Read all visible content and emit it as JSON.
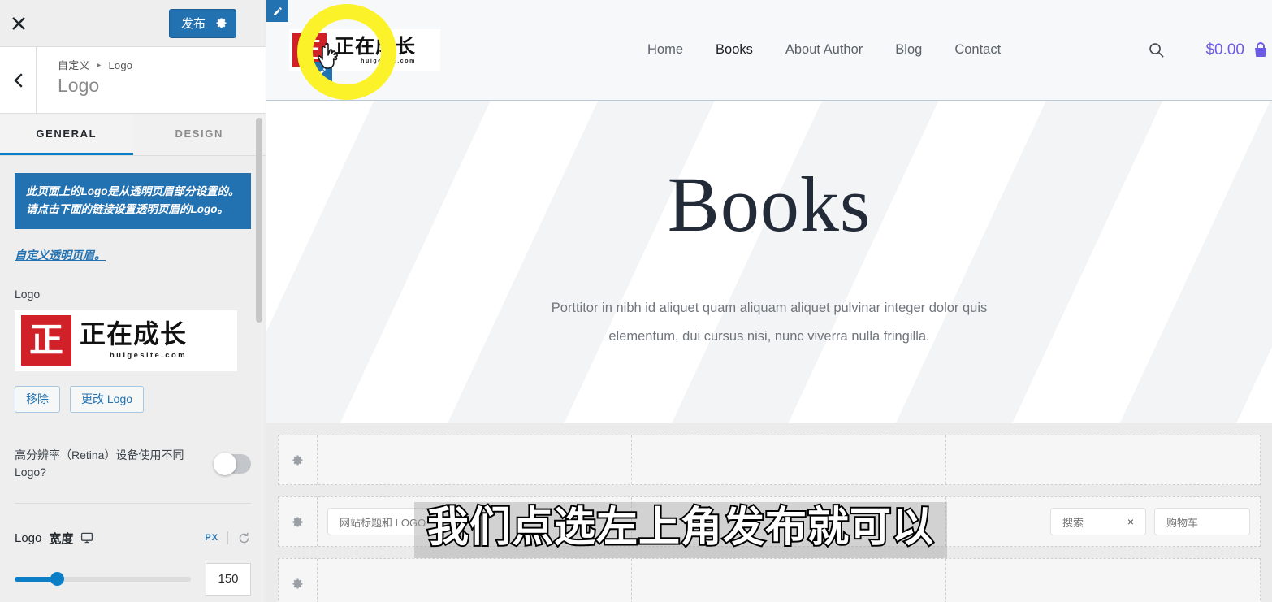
{
  "customizer": {
    "close_icon": "close-icon",
    "publish_label": "发布",
    "publish_gear_icon": "gear-icon",
    "back_icon": "chevron-left-icon",
    "breadcrumb_root": "自定义",
    "breadcrumb_sep": "▸",
    "breadcrumb_current": "Logo",
    "panel_title": "Logo",
    "tabs": [
      {
        "label": "GENERAL",
        "active": true
      },
      {
        "label": "DESIGN",
        "active": false
      }
    ],
    "notice_text": "此页面上的Logo是从透明页眉部分设置的。 请点击下面的链接设置透明页眉的Logo。",
    "notice_link": "自定义透明页眉。",
    "logo_field_label": "Logo",
    "logo": {
      "seal_char": "正",
      "cn_text": "正在成长",
      "domain": "huigesite.com",
      "seal_color": "#cf2127"
    },
    "remove_label": "移除",
    "change_label": "更改 Logo",
    "retina_label": "高分辨率（Retina）设备使用不同Logo?",
    "retina_enabled": false,
    "width_label_prefix": "Logo",
    "width_label_strong": "宽度",
    "width_device_icon": "desktop-icon",
    "width_unit": "PX",
    "width_reset_icon": "reset-icon",
    "width_value": "150"
  },
  "site": {
    "nav": [
      {
        "label": "Home",
        "current": false
      },
      {
        "label": "Books",
        "current": true
      },
      {
        "label": "About Author",
        "current": false
      },
      {
        "label": "Blog",
        "current": false
      },
      {
        "label": "Contact",
        "current": false
      }
    ],
    "search_icon": "search-icon",
    "cart_amount": "$0.00",
    "cart_icon": "shopping-cart-icon",
    "hero_title": "Books",
    "hero_paragraph": "Porttitor in nibh id aliquet quam aliquam aliquet pulvinar integer dolor quis elementum, dui cursus nisi, nunc viverra nulla fringilla.",
    "accent_cart_color": "#6b5ce7"
  },
  "builder": {
    "gear_icon": "gear-icon",
    "rows": [
      {
        "cells": [
          {},
          {},
          {}
        ]
      },
      {
        "cells": [
          {
            "chip": "网站标题和 LOGO"
          },
          {},
          {
            "chip": "搜索",
            "chip_x": "×",
            "chip2": "购物车"
          }
        ]
      },
      {
        "cells": [
          {},
          {},
          {}
        ]
      }
    ]
  },
  "overlay": {
    "caption": "我们点选左上角发布就可以"
  },
  "annotations": {
    "highlight_ring_color": "#fbf22a",
    "edit_pencil_icon": "pencil-icon",
    "cursor_icon": "pointer-hand-cursor"
  }
}
